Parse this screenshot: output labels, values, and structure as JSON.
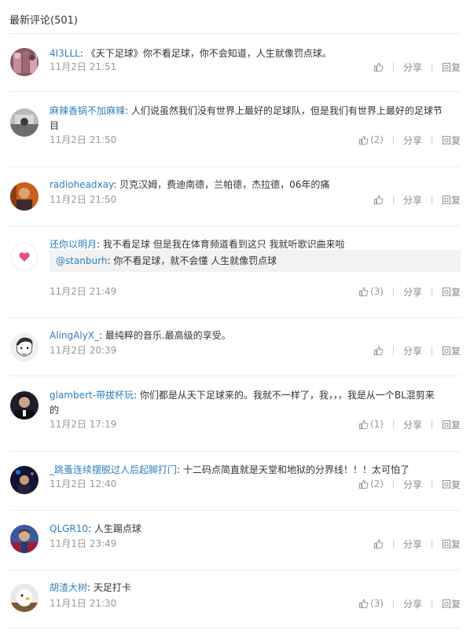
{
  "header": {
    "title": "最新评论(501)"
  },
  "labels": {
    "share": "分享",
    "reply": "回复"
  },
  "comments": [
    {
      "user": "4I3LLL",
      "sep": ":",
      "text": "《天下足球》你不看足球，你不会知道，人生就像罚点球。",
      "time": "11月2日 21:51",
      "likes": "",
      "avatar": "avatar-pink-crowd"
    },
    {
      "user": "麻辣香锅不加麻辣",
      "sep": ":",
      "text": "人们说虽然我们没有世界上最好的足球队，但是我们有世界上最好的足球节目",
      "time": "11月2日 21:50",
      "likes": "(2)",
      "avatar": "avatar-gray-street"
    },
    {
      "user": "radioheadxay",
      "sep": ":",
      "text": "贝克汉姆，费迪南德，兰帕德，杰拉德，06年的痛",
      "time": "11月2日 21:50",
      "likes": "",
      "avatar": "avatar-orange-portrait"
    },
    {
      "user": "还你以明月",
      "sep": ":",
      "text": "我不看足球 但是我在体育频道看到这只 我就听歌识曲来啦",
      "time": "11月2日 21:49",
      "likes": "(3)",
      "avatar": "avatar-heart",
      "quote": {
        "user": "@stanburh",
        "text": "你不看足球，就不会懂 人生就像罚点球"
      }
    },
    {
      "user": "AlingAlyX_",
      "sep": ":",
      "text": "最纯粹的音乐.最高级的享受。",
      "time": "11月2日 20:39",
      "likes": "",
      "avatar": "avatar-sketch-face"
    },
    {
      "user": "glambert-带拔杯玩",
      "sep": ":",
      "text": "你们都是从天下足球来的。我就不一样了，我，，，我是从一个BL混剪来的",
      "time": "11月2日 17:19",
      "likes": "(1)",
      "avatar": "avatar-dark-man"
    },
    {
      "user": "_跳蚤连续摆脱过人后起脚打门",
      "sep": ":",
      "text": "十二码点简直就是天堂和地狱的分界线！！！太可怕了",
      "time": "11月2日 12:40",
      "likes": "(2)",
      "avatar": "avatar-night-stage"
    },
    {
      "user": "QLGR10",
      "sep": ":",
      "text": "人生踢点球",
      "time": "11月1日 23:49",
      "likes": "",
      "avatar": "avatar-footballer"
    },
    {
      "user": "胡渣大树",
      "sep": ":",
      "text": "天足打卡",
      "time": "11月1日 21:30",
      "likes": "(3)",
      "avatar": "avatar-white-bird"
    }
  ]
}
